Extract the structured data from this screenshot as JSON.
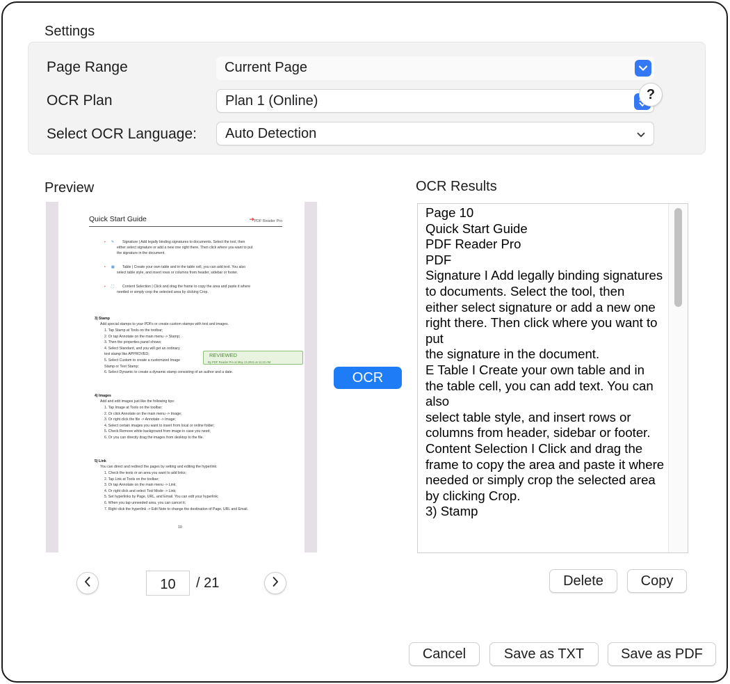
{
  "settings": {
    "title": "Settings",
    "page_range": {
      "label": "Page Range",
      "value": "Current Page"
    },
    "ocr_plan": {
      "label": "OCR Plan",
      "value": "Plan 1 (Online)"
    },
    "ocr_language": {
      "label": "Select OCR Language:",
      "value": "Auto Detection"
    },
    "help_label": "?"
  },
  "preview": {
    "title": "Preview",
    "page": {
      "header_title": "Quick Start Guide",
      "header_brand": "PDF Reader Pro",
      "bullets": [
        "Signature | Add legally binding signatures to documents. Select the tool, then",
        "either select signature or add a new one right there. Then click where you want to put",
        "the signature in the document.",
        "Table | Create your own table and in the table cell, you can add text. You also",
        "select table style, and insert rows or columns from header, sidebar or footer.",
        "Content Selection | Click and drag the frame to copy the area and paste it where",
        "needed or simply crop the selected area by clicking Crop."
      ],
      "stamp_heading": "3) Stamp",
      "stamp_intro": "Add special stamps to your PDFs or create custom stamps with text and images.",
      "stamp_steps": [
        "1.  Tap Stamp at Tools on the toolbar;",
        "2.  Or tap Annotate on the main menu -> Stamp;",
        "3.  Then the properties panel shows;",
        "4.  Select Standard, and you will get an ordinary",
        "     text stamp like APPROVED;",
        "5.  Select Custom to create a customized Image",
        "     Stamp or Text Stamp;",
        "6.  Select Dynamic to create a dynamic stamp consisting of an author and a date."
      ],
      "stamp_sample_main": "REVIEWED",
      "stamp_sample_sub": "By PDF Reader Pro at May 13,2021 at 11:22 AM",
      "images_heading": "4) Images",
      "images_intro": "Add and edit images just like the following tips:",
      "images_steps": [
        "1.  Tap Image at Tools on the toolbar;",
        "2.  Or click Annotate on the main menu -> Image;",
        "3.  Or right click the file -> Annotate -> Image;",
        "4.  Select certain images you want to insert from local or online folder;",
        "5.  Check Remove white background from image in case you need;",
        "6.  Or you can directly drag the images from desktop to the file."
      ],
      "link_heading": "5) Link",
      "link_intro": "You can direct and redirect the pages by setting and editing the hyperlink:",
      "link_steps": [
        "1.  Check the texts or an area you want to add links;",
        "2.  Tap Link at Tools on the toolbar;",
        "3.  Or tap Annotate on the main menu -> Link;",
        "4.  Or right click and select Tool Mode -> Link;",
        "5.  Set hyperlinks by Page, URL, and Email. You can edit your hyperlink;",
        "6.  When you tap unneeded area, you can cancel it;",
        "7.  Right click the hyperlink -> Edit Note to change the destination of Page, URL and Email."
      ],
      "page_number": "10"
    },
    "current_page": "10",
    "total_pages": "/ 21"
  },
  "ocr_button_label": "OCR",
  "results": {
    "title": "OCR Results",
    "text": "Page 10\nQuick Start Guide\nPDF Reader Pro\nPDF\nSignature I Add legally binding signatures to documents. Select the tool, then\neither select signature or add a new one right there. Then click where you want to put\nthe signature in the document.\nE Table I Create your own table and in the table cell, you can add text. You can also\nselect table style, and insert rows or columns from header, sidebar or footer.\nContent Selection I Click and drag the frame to copy the area and paste it where\nneeded or simply crop the selected area by clicking Crop.\n3) Stamp",
    "delete_label": "Delete",
    "copy_label": "Copy"
  },
  "footer": {
    "cancel_label": "Cancel",
    "save_txt_label": "Save as TXT",
    "save_pdf_label": "Save as PDF"
  },
  "colors": {
    "accent": "#1e7cf7",
    "link": "#2a7fd4",
    "stamp_green": "#4c8a35"
  }
}
